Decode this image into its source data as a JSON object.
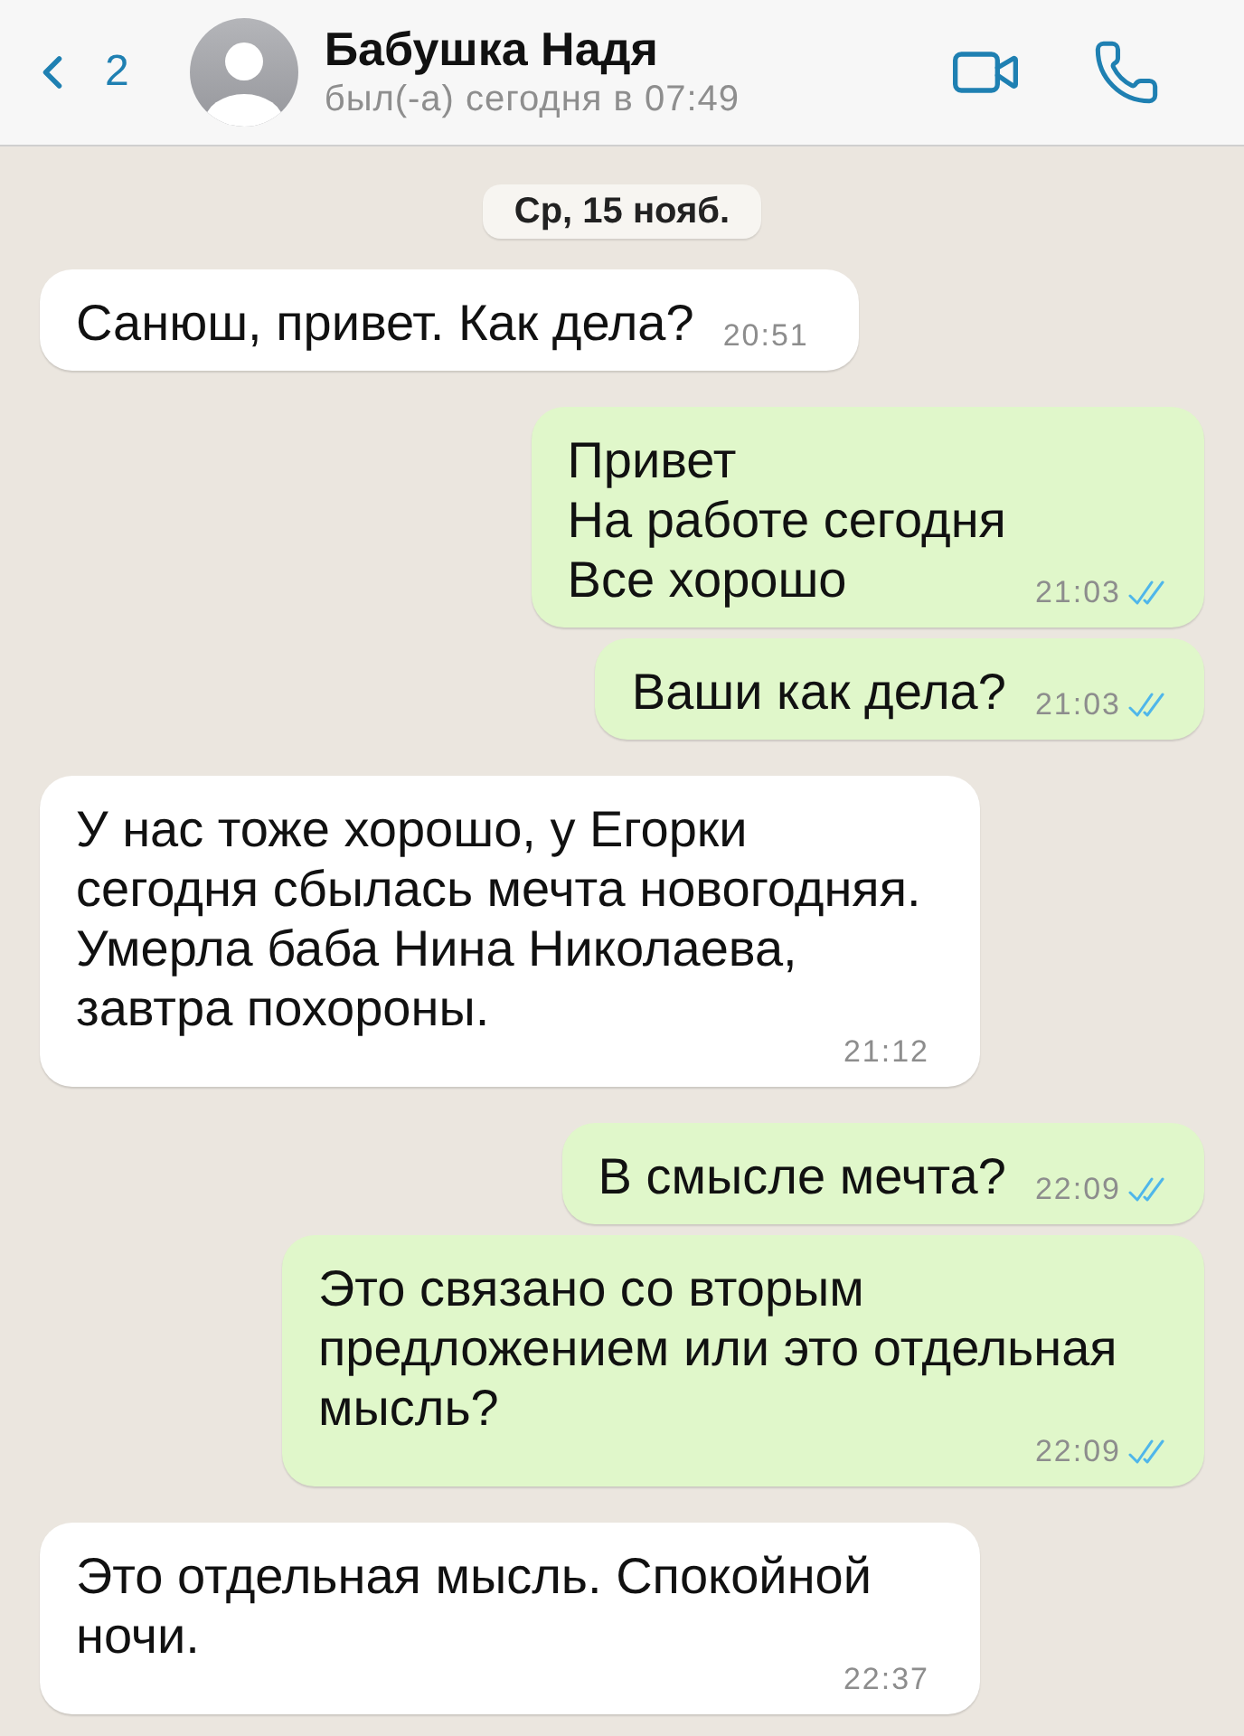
{
  "header": {
    "back": {
      "count": "2"
    },
    "contact": {
      "name": "Бабушка Надя",
      "status": "был(-а) сегодня в 07:49"
    }
  },
  "date_divider": "Ср, 15 нояб.",
  "messages": [
    {
      "kind": "incoming",
      "text": "Санюш, привет. Как дела?",
      "time": "20:51"
    },
    {
      "kind": "outgoing",
      "text": "Привет\nНа работе сегодня\nВсе хорошо",
      "time": "21:03",
      "read": true
    },
    {
      "kind": "outgoing",
      "text": "Ваши как дела?",
      "time": "21:03",
      "read": true
    },
    {
      "kind": "incoming",
      "text": "У нас тоже хорошо, у Егорки сегодня сбылась мечта новогодняя. Умерла баба Нина Николаева, завтра похороны.",
      "time": "21:12"
    },
    {
      "kind": "outgoing",
      "text": "В смысле мечта?",
      "time": "22:09",
      "read": true
    },
    {
      "kind": "outgoing",
      "text": "Это связано со вторым предложением или это отдельная мысль?",
      "time": "22:09",
      "read": true
    },
    {
      "kind": "incoming",
      "text": "Это отдельная мысль. Спокойной ночи.",
      "time": "22:37"
    }
  ]
}
